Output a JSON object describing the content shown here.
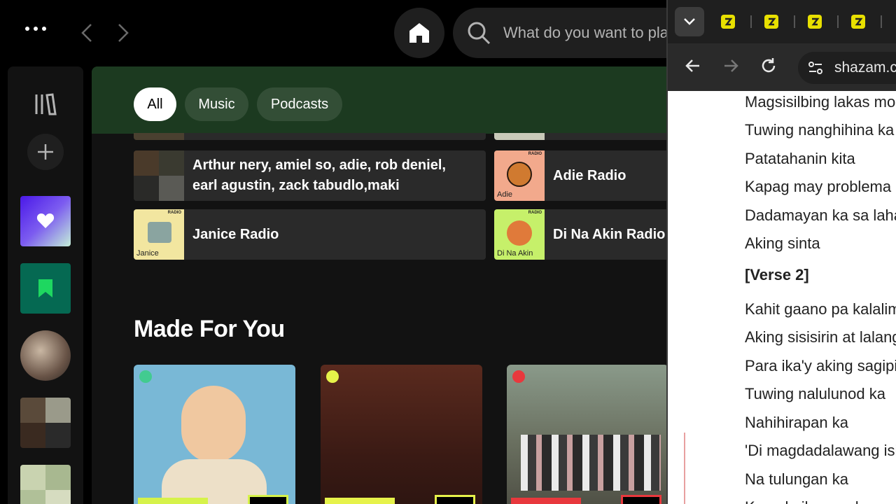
{
  "app": {
    "nav": {
      "back_icon": "chevron-left-icon",
      "forward_icon": "chevron-right-icon",
      "menu_icon": "more-dots-icon"
    },
    "search": {
      "placeholder": "What do you want to play?"
    }
  },
  "filters": [
    {
      "label": "All",
      "active": true
    },
    {
      "label": "Music",
      "active": false
    },
    {
      "label": "Podcasts",
      "active": false
    }
  ],
  "shortcuts": [
    {
      "title_line1": "Arthur nery, amiel so, adie, rob deniel,",
      "title_line2": "earl agustin, zack tabudlo,maki"
    },
    {
      "title": "Adie Radio",
      "thumb_caption": "Adie",
      "thumb_tag": "RADIO"
    },
    {
      "title": "Janice Radio",
      "thumb_caption": "Janice",
      "thumb_tag": "RADIO"
    },
    {
      "title": "Di Na Akin Radio",
      "thumb_caption": "Di Na Akin",
      "thumb_tag": "RADIO"
    }
  ],
  "section": {
    "title": "Made For You"
  },
  "mixes": [
    {
      "band_color": "#d6f24a",
      "dot_color": "#1ed760"
    },
    {
      "band_color": "#e6f24a",
      "dot_color": "#1ed760"
    },
    {
      "band_color": "#e8383d",
      "dot_color": "#e8383d"
    }
  ],
  "browser": {
    "url": "shazam.com",
    "lyrics": [
      {
        "text": "Magsisilbing lakas mo"
      },
      {
        "text": "Tuwing nanghihina ka"
      },
      {
        "text": "Patatahanin kita"
      },
      {
        "text": "Kapag may problema"
      },
      {
        "text": "Dadamayan ka sa lahat"
      },
      {
        "text": "Aking sinta"
      },
      {
        "text": "[Verse 2]",
        "head": true
      },
      {
        "text": "Kahit gaano pa kalalim"
      },
      {
        "text": "Aking sisisirin at lalanguyin"
      },
      {
        "text": "Para ika'y aking sagipin"
      },
      {
        "text": "Tuwing nalulunod ka"
      },
      {
        "text": "Nahihirapan ka"
      },
      {
        "text": "'Di magdadalawang isip"
      },
      {
        "text": "Na tulungan ka"
      },
      {
        "text": "Kung kailangan ko"
      }
    ]
  }
}
